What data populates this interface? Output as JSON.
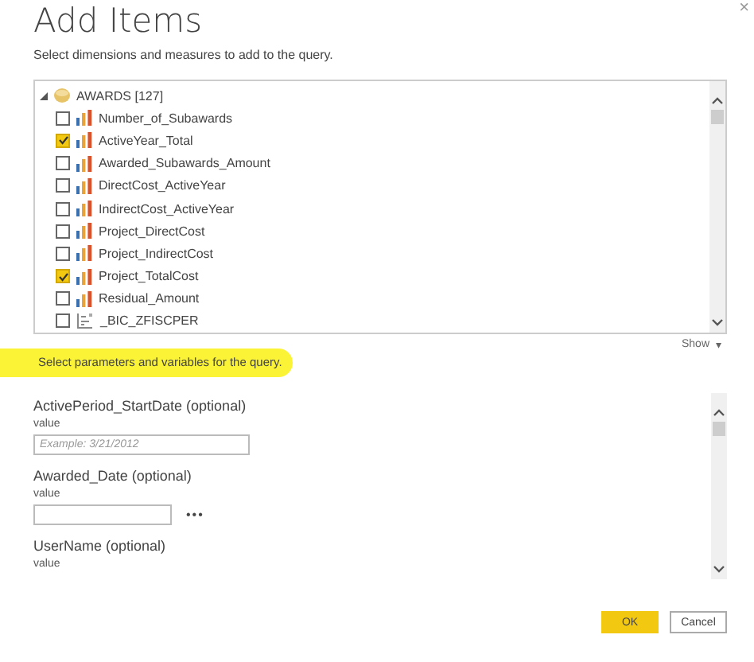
{
  "window": {
    "title": "Add Items",
    "close": "×"
  },
  "instruction": "Select dimensions and measures to add to the query.",
  "tree": {
    "root": {
      "label": "AWARDS [127]",
      "expanded": true,
      "children": [
        {
          "label": "Number_of_Subawards",
          "kind": "measure",
          "checked": false
        },
        {
          "label": "ActiveYear_Total",
          "kind": "measure",
          "checked": true
        },
        {
          "label": "Awarded_Subawards_Amount",
          "kind": "measure",
          "checked": false
        },
        {
          "label": "DirectCost_ActiveYear",
          "kind": "measure",
          "checked": false
        },
        {
          "label": "IndirectCost_ActiveYear",
          "kind": "measure",
          "checked": false
        },
        {
          "label": "Project_DirectCost",
          "kind": "measure",
          "checked": false
        },
        {
          "label": "Project_IndirectCost",
          "kind": "measure",
          "checked": false
        },
        {
          "label": "Project_TotalCost",
          "kind": "measure",
          "checked": true
        },
        {
          "label": "Residual_Amount",
          "kind": "measure",
          "checked": false
        },
        {
          "label": "_BIC_ZFISCPER",
          "kind": "attribute",
          "checked": false
        }
      ]
    }
  },
  "show_toggle": "Show",
  "show_caret": "▾",
  "parameters_note": "Select parameters and variables for the query.",
  "parameters": [
    {
      "label": "ActivePeriod_StartDate (optional)",
      "sublabel": "value",
      "kind": "text",
      "placeholder": "Example: 3/21/2012"
    },
    {
      "label": "Awarded_Date (optional)",
      "sublabel": "value",
      "kind": "picker",
      "picker": "•••"
    },
    {
      "label": "UserName (optional)",
      "sublabel": "value",
      "kind": "none"
    }
  ],
  "buttons": [
    {
      "label": "OK",
      "primary": true
    },
    {
      "label": "Cancel",
      "primary": false
    }
  ]
}
